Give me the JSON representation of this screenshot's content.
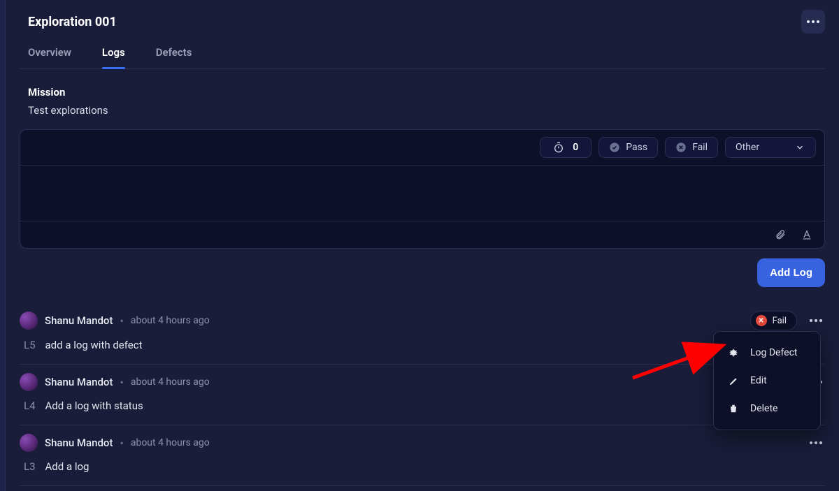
{
  "header": {
    "title": "Exploration 001"
  },
  "tabs": [
    {
      "label": "Overview",
      "active": false
    },
    {
      "label": "Logs",
      "active": true
    },
    {
      "label": "Defects",
      "active": false
    }
  ],
  "mission": {
    "label": "Mission",
    "text": "Test explorations"
  },
  "composer": {
    "timer_value": "0",
    "pass_label": "Pass",
    "fail_label": "Fail",
    "select_value": "Other"
  },
  "add_log_label": "Add Log",
  "logs": [
    {
      "author": "Shanu Mandot",
      "time": "about 4 hours ago",
      "id": "L5",
      "text": "add a log with defect",
      "status": "Fail"
    },
    {
      "author": "Shanu Mandot",
      "time": "about 4 hours ago",
      "id": "L4",
      "text": "Add a log with status",
      "status": null
    },
    {
      "author": "Shanu Mandot",
      "time": "about 4 hours ago",
      "id": "L3",
      "text": "Add a log",
      "status": null
    }
  ],
  "context_menu": {
    "log_defect": "Log Defect",
    "edit": "Edit",
    "delete": "Delete"
  }
}
